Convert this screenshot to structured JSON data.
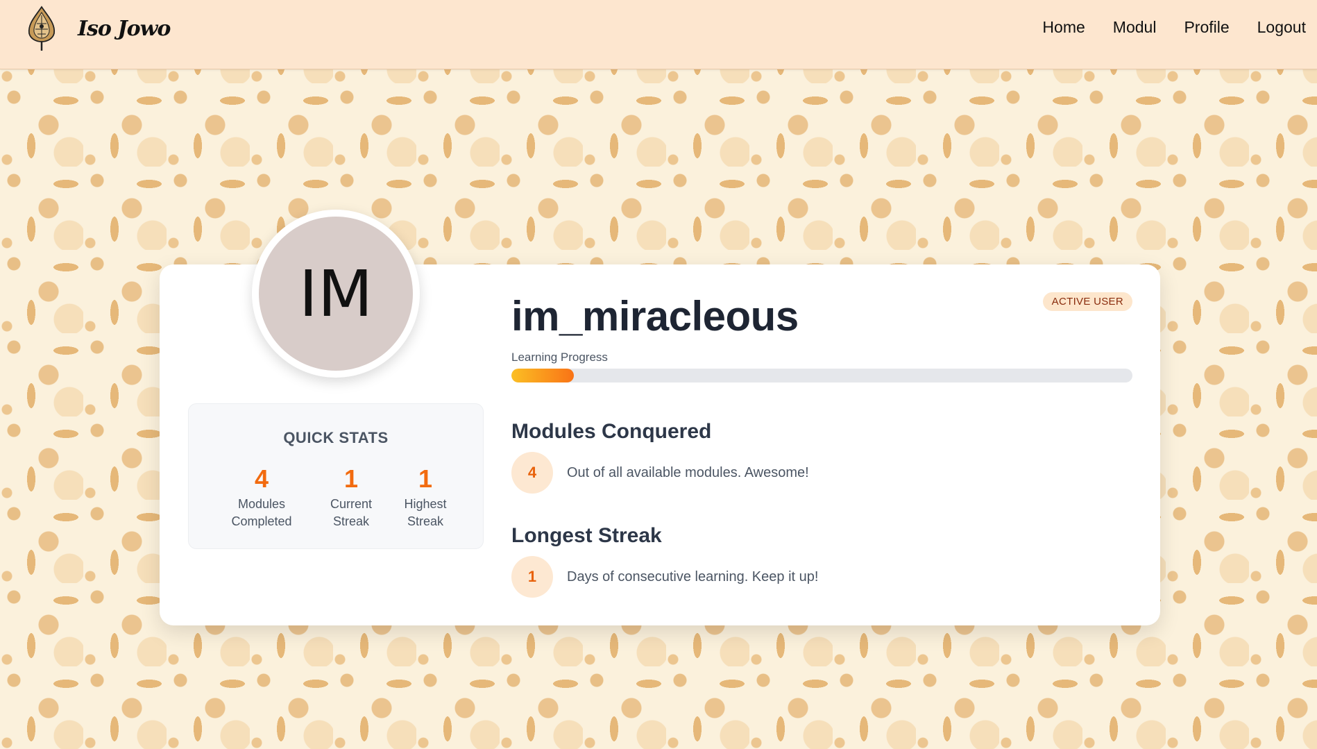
{
  "nav": {
    "brand_name": "Iso Jowo",
    "logo_icon": "gunungan-icon",
    "links": [
      "Home",
      "Modul",
      "Profile",
      "Logout"
    ]
  },
  "profile": {
    "initials": "IM",
    "username": "im_miracleous",
    "badge": "ACTIVE USER",
    "progress_label": "Learning Progress",
    "progress_fraction": 0.1
  },
  "quick_stats": {
    "title": "QUICK STATS",
    "items": [
      {
        "value": "4",
        "label_line1": "Modules",
        "label_line2": "Completed"
      },
      {
        "value": "1",
        "label_line1": "Current",
        "label_line2": "Streak"
      },
      {
        "value": "1",
        "label_line1": "Highest",
        "label_line2": "Streak"
      }
    ]
  },
  "sections": {
    "modules": {
      "title": "Modules Conquered",
      "value": "4",
      "desc": "Out of all available modules. Awesome!"
    },
    "streak": {
      "title": "Longest Streak",
      "value": "1",
      "desc": "Days of consecutive learning. Keep it up!"
    }
  },
  "colors": {
    "accent": "#f26b0f",
    "navbar_bg": "#fde6cf",
    "avatar_bg": "#d8ccc9",
    "progress_start": "#fbbf24",
    "progress_end": "#f97316"
  }
}
